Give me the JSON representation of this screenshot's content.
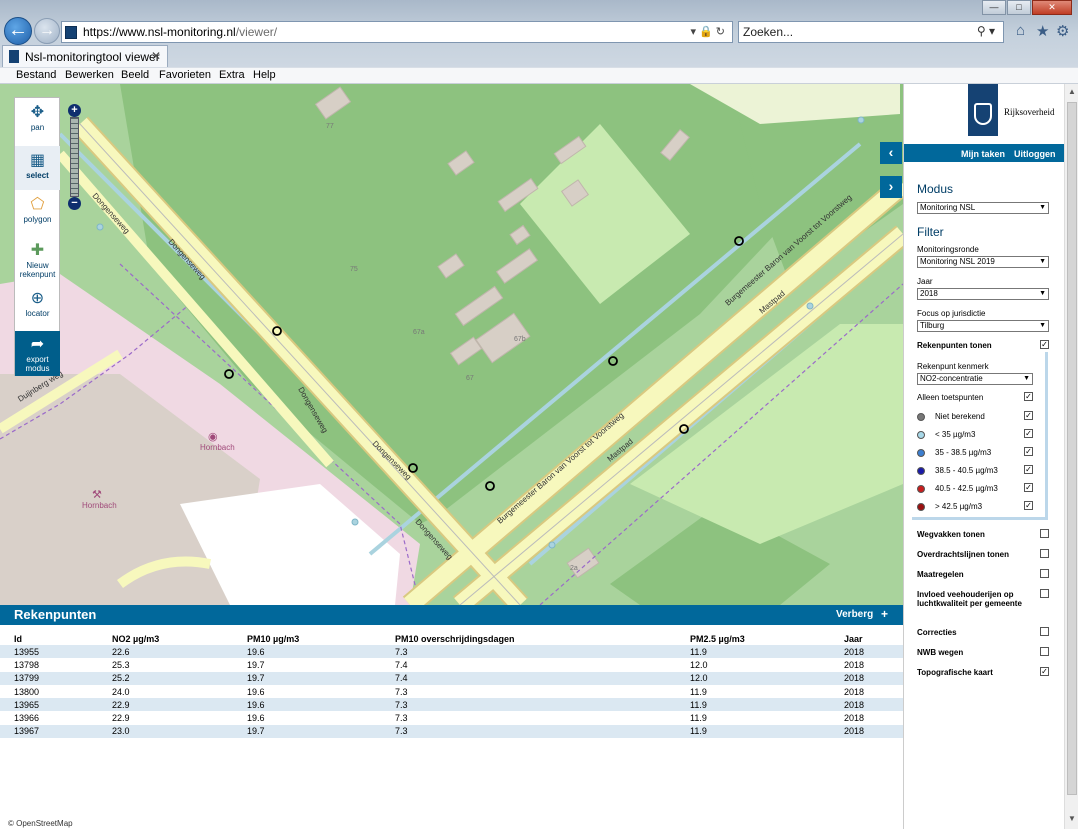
{
  "browser": {
    "url_domain": "https://www.nsl-monitoring.nl",
    "url_path": "/viewer/",
    "search_placeholder": "Zoeken...",
    "tab_title": "Nsl-monitoringtool viewer",
    "menu": [
      "Bestand",
      "Bewerken",
      "Beeld",
      "Favorieten",
      "Extra",
      "Help"
    ]
  },
  "map": {
    "tools": [
      {
        "label": "pan",
        "icon": "move-icon"
      },
      {
        "label": "select",
        "icon": "select-box-icon"
      },
      {
        "label": "polygon",
        "icon": "polygon-icon"
      },
      {
        "label": "Nieuw rekenpunt",
        "icon": "new-point-icon"
      },
      {
        "label": "locator",
        "icon": "crosshair-icon"
      },
      {
        "label": "export modus",
        "icon": "export-arrow-icon"
      }
    ],
    "street_labels": [
      "Dongenseweg",
      "Dongenseweg",
      "Dongenseweg",
      "Dongenseweg",
      "Dongenseweg",
      "Burgemeester Baron van Voorst tot Voorstweg",
      "Burgemeester Baron van Voorst tot Voorstweg",
      "Mastpad",
      "Mastpad",
      "Duijnberg weg",
      "Hornbach",
      "Hornbach"
    ],
    "house_numbers": [
      "77",
      "75",
      "67a",
      "67",
      "67b",
      "2a"
    ],
    "colors": {
      "grass": "#a9d39c",
      "forest": "#8dc27f",
      "meadow": "#c8eab0",
      "road": "#f7f8bd",
      "road_border": "#d9c980",
      "retail": "#f0d9e3",
      "building": "#d7cfc6",
      "water": "#aad3df"
    }
  },
  "results": {
    "title": "Rekenpunten",
    "hide_label": "Verberg",
    "plus_label": "+",
    "columns": [
      "Id",
      "NO2 µg/m3",
      "PM10 µg/m3",
      "PM10 overschrijdingsdagen",
      "PM2.5 µg/m3",
      "Jaar"
    ],
    "rows": [
      [
        "13955",
        "22.6",
        "19.6",
        "7.3",
        "11.9",
        "2018"
      ],
      [
        "13798",
        "25.3",
        "19.7",
        "7.4",
        "12.0",
        "2018"
      ],
      [
        "13799",
        "25.2",
        "19.7",
        "7.4",
        "12.0",
        "2018"
      ],
      [
        "13800",
        "24.0",
        "19.6",
        "7.3",
        "11.9",
        "2018"
      ],
      [
        "13965",
        "22.9",
        "19.6",
        "7.3",
        "11.9",
        "2018"
      ],
      [
        "13966",
        "22.9",
        "19.6",
        "7.3",
        "11.9",
        "2018"
      ],
      [
        "13967",
        "23.0",
        "19.7",
        "7.3",
        "11.9",
        "2018"
      ]
    ],
    "attribution": "© OpenStreetMap"
  },
  "side": {
    "logo_text": "Rijksoverheid",
    "mijn_taken": "Mijn taken",
    "uitloggen": "Uitloggen",
    "modus_heading": "Modus",
    "modus_value": "Monitoring NSL",
    "filter_heading": "Filter",
    "ronde_label": "Monitoringsronde",
    "ronde_value": "Monitoring NSL 2019",
    "jaar_label": "Jaar",
    "jaar_value": "2018",
    "focus_label": "Focus op jurisdictie",
    "focus_value": "Tilburg",
    "rekenpunten_tonen": "Rekenpunten tonen",
    "kenmerk_label": "Rekenpunt kenmerk",
    "kenmerk_value": "NO2-concentratie",
    "alleen_toets": "Alleen toetspunten",
    "legend": [
      {
        "label": "Niet berekend",
        "color": "#777777"
      },
      {
        "label": "< 35 µg/m3",
        "color": "#a8d8e8"
      },
      {
        "label": "35 - 38.5 µg/m3",
        "color": "#3c7fd0"
      },
      {
        "label": "38.5 - 40.5 µg/m3",
        "color": "#1a1aa8"
      },
      {
        "label": "40.5 - 42.5 µg/m3",
        "color": "#c81e1e"
      },
      {
        "label": "> 42.5 µg/m3",
        "color": "#9b1010"
      }
    ],
    "layers": [
      {
        "label": "Wegvakken tonen",
        "checked": false
      },
      {
        "label": "Overdrachtslijnen tonen",
        "checked": false
      },
      {
        "label": "Maatregelen",
        "checked": false
      },
      {
        "label": "Invloed veehouderijen op luchtkwaliteit per gemeente",
        "checked": false
      },
      {
        "label": "Correcties",
        "checked": false
      },
      {
        "label": "NWB wegen",
        "checked": false
      },
      {
        "label": "Topografische kaart",
        "checked": true
      }
    ]
  }
}
